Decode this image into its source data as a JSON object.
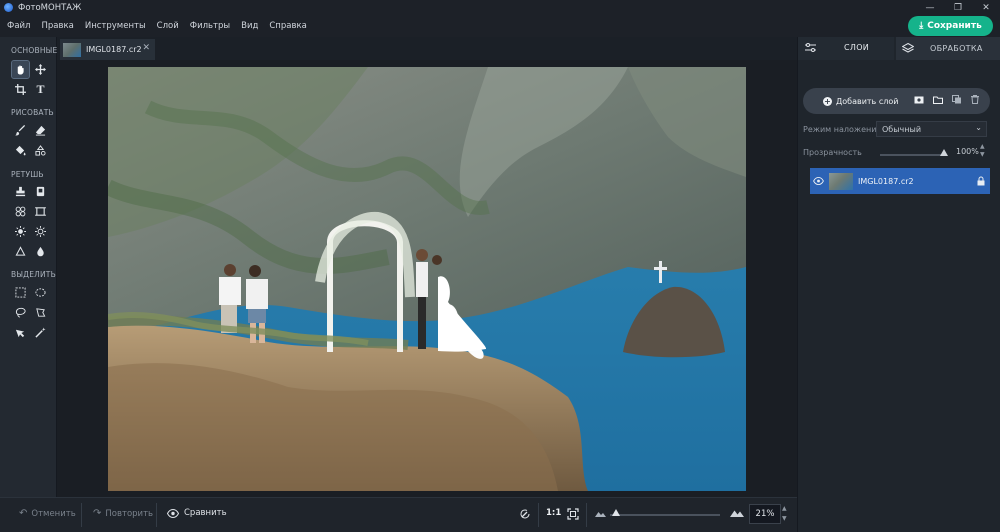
{
  "window": {
    "title": "ФотоМОНТАЖ",
    "controls": [
      "—",
      "❐",
      "✕"
    ]
  },
  "menu": [
    "Файл",
    "Правка",
    "Инструменты",
    "Слой",
    "Фильтры",
    "Вид",
    "Справка"
  ],
  "save_button": {
    "label": "Сохранить",
    "icon": "download-icon"
  },
  "toolbar": {
    "sections": {
      "basic": "ОСНОВНЫЕ",
      "draw": "РИСОВАТЬ",
      "retouch": "РЕТУШЬ",
      "select": "ВЫДЕЛИТЬ"
    },
    "tools": [
      "hand-icon",
      "move-icon",
      "crop-icon",
      "text-icon",
      "brush-icon",
      "eraser-icon",
      "fill-icon",
      "shapes-icon",
      "stamp-icon",
      "patch-icon",
      "clone-icon",
      "frame-icon",
      "lighten-icon",
      "darken-icon",
      "sharpen-icon",
      "blur-icon",
      "rect-select-icon",
      "ellipse-select-icon",
      "lasso-icon",
      "polygon-lasso-icon",
      "magic-select-icon",
      "magic-wand-icon"
    ]
  },
  "document_tab": {
    "label": "IMGL0187.cr2",
    "close": "✕"
  },
  "bottom_bar": {
    "undo": "Отменить",
    "redo": "Повторить",
    "compare": "Сравнить",
    "one_to_one": "1:1",
    "zoom": "21%",
    "zoom_level": 0.05
  },
  "right_panel": {
    "tabs": {
      "layers": "СЛОИ",
      "processing": "ОБРАБОТКА"
    },
    "add_layer": "Добавить слой",
    "blend_mode_label": "Режим наложения:",
    "blend_mode_value": "Обычный",
    "opacity_label": "Прозрачность",
    "opacity_value": "100%",
    "layer": {
      "name": "IMGL0187.cr2"
    }
  },
  "colors": {
    "accent_save": "#15b38b",
    "layer_selected": "#2c63b5",
    "panel_bg": "#1f252c"
  }
}
